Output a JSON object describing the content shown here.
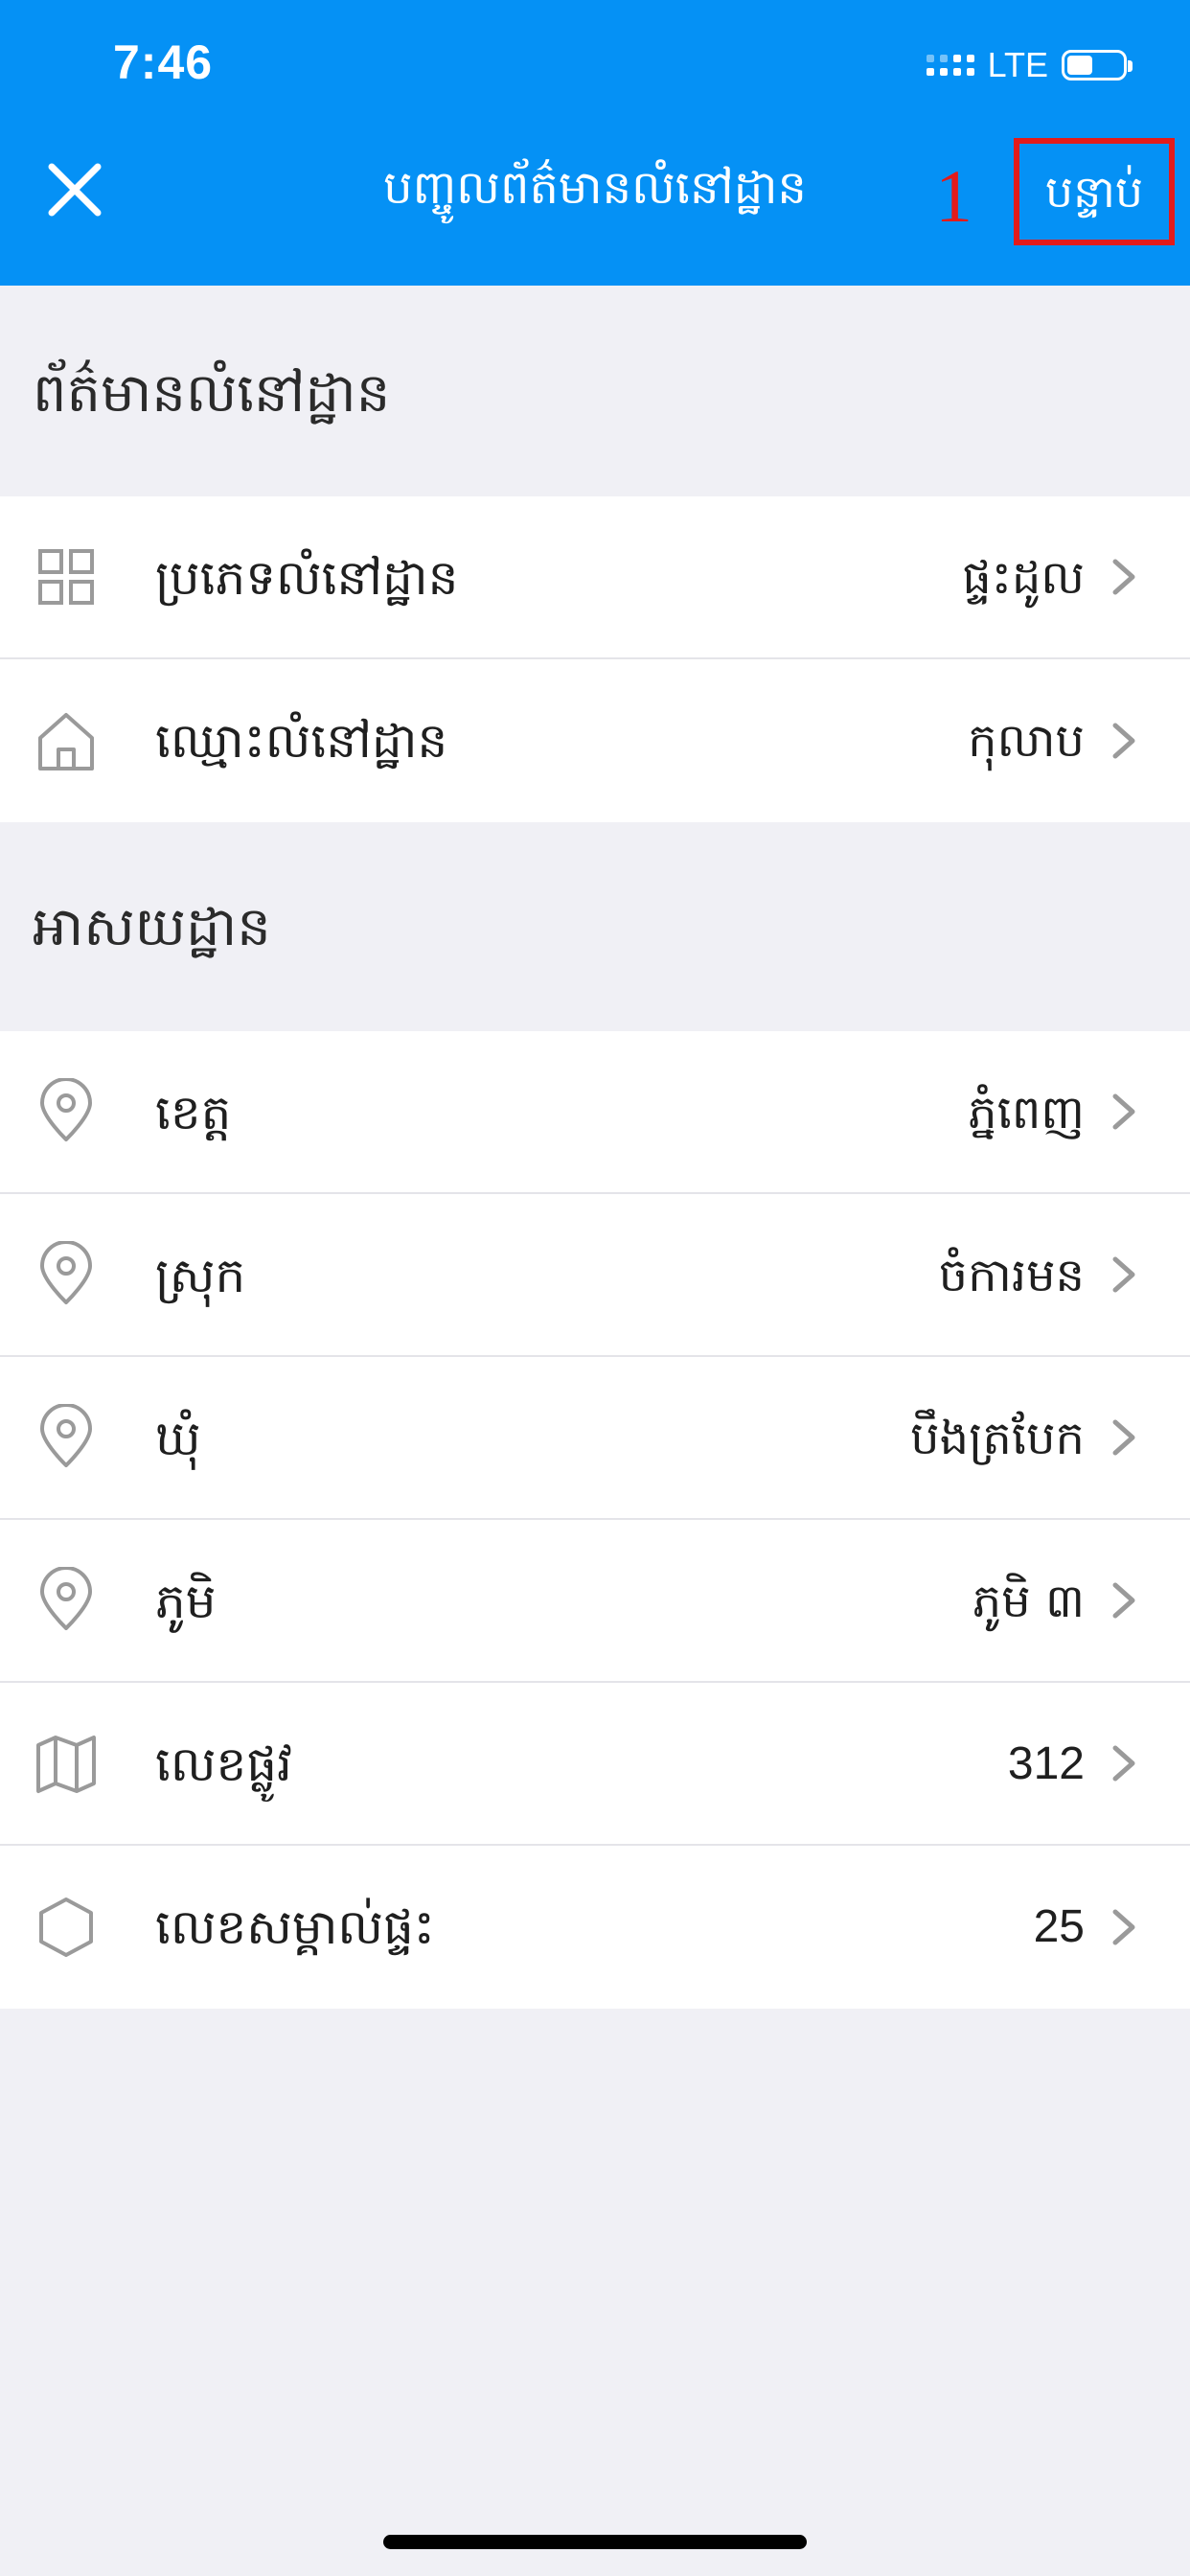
{
  "status_bar": {
    "time": "7:46",
    "network": "LTE"
  },
  "nav": {
    "title": "បញ្ចូលព័ត៌មានលំនៅដ្ឋាន",
    "annotation_number": "1",
    "next_label": "បន្ទាប់"
  },
  "section1": {
    "title": "ព័ត៌មានលំនៅដ្ឋាន",
    "rows": [
      {
        "icon": "grid-icon",
        "label": "ប្រភេទលំនៅដ្ឋាន",
        "value": "ផ្ទះដូល"
      },
      {
        "icon": "house-icon",
        "label": "ឈ្មោះលំនៅដ្ឋាន",
        "value": "កុលាប"
      }
    ]
  },
  "section2": {
    "title": "អាសយដ្ឋាន",
    "rows": [
      {
        "icon": "location-pin-icon",
        "label": "ខេត្ត",
        "value": "ភ្នំពេញ"
      },
      {
        "icon": "location-pin-icon",
        "label": "ស្រុក",
        "value": "ចំការមន"
      },
      {
        "icon": "location-pin-icon",
        "label": "ឃុំ",
        "value": "បឹងត្របែក"
      },
      {
        "icon": "location-pin-icon",
        "label": "ភូមិ",
        "value": "ភូមិ ៣"
      },
      {
        "icon": "map-icon",
        "label": "លេខផ្លូវ",
        "value": "312"
      },
      {
        "icon": "hexagon-icon",
        "label": "លេខសម្គាល់ផ្ទះ",
        "value": "25"
      }
    ]
  },
  "colors": {
    "header": "#0591f5",
    "annotation": "#e31b1b",
    "background": "#f0f0f5",
    "icon_gray": "#9a9a9a"
  }
}
